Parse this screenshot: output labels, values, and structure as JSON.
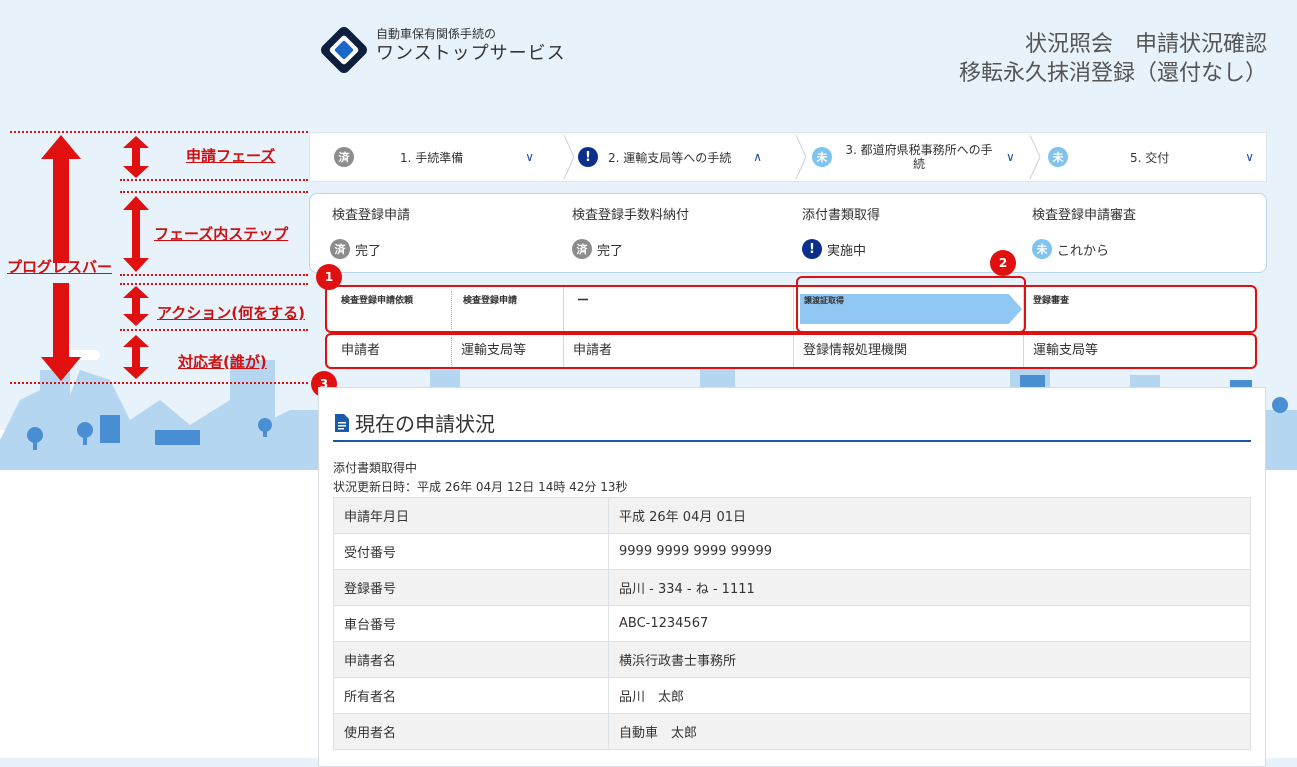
{
  "header": {
    "logo_small": "自動車保有関係手続の",
    "logo_large": "ワンストップサービス",
    "title_line1": "状況照会　申請状況確認",
    "title_line2": "移転永久抹消登録（還付なし）"
  },
  "annotations": {
    "phase": "申請フェーズ",
    "step": "フェーズ内ステップ",
    "progress": "プログレスバー",
    "action": "アクション(何をする)",
    "responder": "対応者(誰が)"
  },
  "phases": [
    {
      "badge": "済",
      "label": "1. 手続準備",
      "state": "done",
      "chevron": "down"
    },
    {
      "badge": "!",
      "label": "2. 運輸支局等への手続",
      "state": "now",
      "chevron": "up"
    },
    {
      "badge": "未",
      "label": "3. 都道府県税事務所への手続",
      "state": "todo",
      "chevron": "down"
    },
    {
      "badge": "未",
      "label": "5. 交付",
      "state": "todo",
      "chevron": "down"
    }
  ],
  "steps": [
    {
      "title": "検査登録申請",
      "badge": "済",
      "status": "完了",
      "state": "done"
    },
    {
      "title": "検査登録手数料納付",
      "badge": "済",
      "status": "完了",
      "state": "done"
    },
    {
      "title": "添付書類取得",
      "badge": "!",
      "status": "実施中",
      "state": "now"
    },
    {
      "title": "検査登録申請審査",
      "badge": "未",
      "status": "これから",
      "state": "todo"
    }
  ],
  "actions": [
    "検査登録申請依頼",
    "検査登録申請",
    "ー",
    "譲渡証取得",
    "登録審査"
  ],
  "responders": [
    "申請者",
    "運輸支局等",
    "申請者",
    "登録情報処理機関",
    "運輸支局等"
  ],
  "markers": [
    "1",
    "2",
    "3"
  ],
  "status_card": {
    "title": "現在の申請状況",
    "state_text": "添付書類取得中",
    "updated_text": "状況更新日時：平成 26年 04月 12日 14時 42分 13秒",
    "rows": [
      {
        "key": "申請年月日",
        "value": "平成 26年 04月 01日"
      },
      {
        "key": "受付番号",
        "value": "9999 9999 9999 99999"
      },
      {
        "key": "登録番号",
        "value": "品川 - 334 - ね - 1111"
      },
      {
        "key": "車台番号",
        "value": "ABC-1234567"
      },
      {
        "key": "申請者名",
        "value": "横浜行政書士事務所"
      },
      {
        "key": "所有者名",
        "value": "品川　太郎"
      },
      {
        "key": "使用者名",
        "value": "自動車　太郎"
      }
    ]
  },
  "colors": {
    "annotation_red": "#e01010",
    "done_gray": "#8c8c8c",
    "todo_blue": "#7fc3ef",
    "current_navy": "#0b2f8a",
    "progress_arrow": "#90c8f3"
  }
}
